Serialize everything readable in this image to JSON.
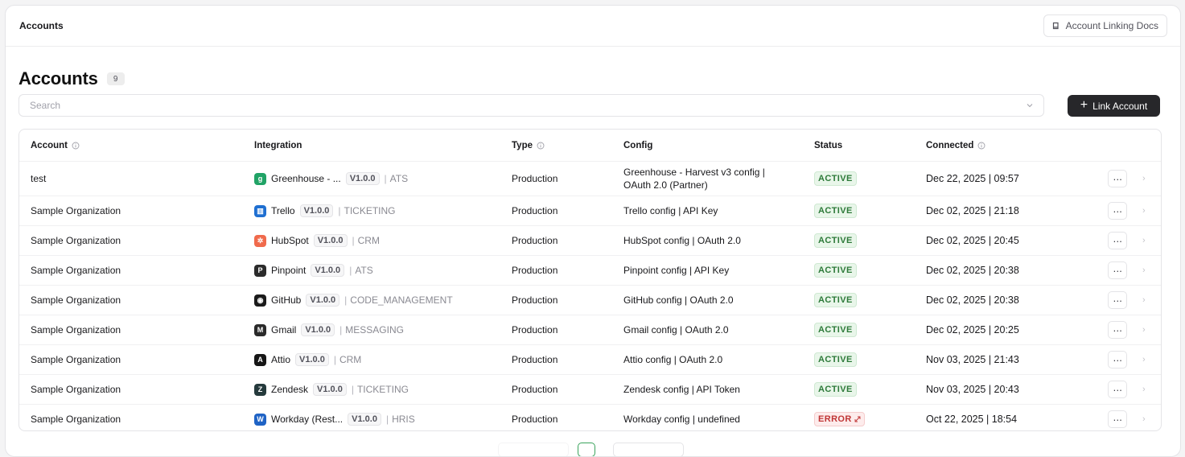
{
  "topbar": {
    "title": "Accounts",
    "docs_label": "Account Linking Docs"
  },
  "page": {
    "title": "Accounts",
    "count": "9"
  },
  "search": {
    "placeholder": "Search",
    "value": ""
  },
  "link_button": {
    "label": "Link Account"
  },
  "table": {
    "headers": {
      "account": "Account",
      "integration": "Integration",
      "type": "Type",
      "config": "Config",
      "status": "Status",
      "connected": "Connected"
    },
    "rows": [
      {
        "account": "test",
        "integration": "Greenhouse - ...",
        "version": "V1.0.0",
        "category": "ATS",
        "type": "Production",
        "config": "Greenhouse - Harvest v3 config | OAuth 2.0 (Partner)",
        "status": "ACTIVE",
        "connected": "Dec 22, 2025 | 09:57",
        "logo_color": "#21a366",
        "logo_glyph": "g"
      },
      {
        "account": "Sample Organization",
        "integration": "Trello",
        "version": "V1.0.0",
        "category": "TICKETING",
        "type": "Production",
        "config": "Trello config | API Key",
        "status": "ACTIVE",
        "connected": "Dec 02, 2025 | 21:18",
        "logo_color": "#1f6fd1",
        "logo_glyph": "▥"
      },
      {
        "account": "Sample Organization",
        "integration": "HubSpot",
        "version": "V1.0.0",
        "category": "CRM",
        "type": "Production",
        "config": "HubSpot config | OAuth 2.0",
        "status": "ACTIVE",
        "connected": "Dec 02, 2025 | 20:45",
        "logo_color": "#f06a4c",
        "logo_glyph": "✲"
      },
      {
        "account": "Sample Organization",
        "integration": "Pinpoint",
        "version": "V1.0.0",
        "category": "ATS",
        "type": "Production",
        "config": "Pinpoint config | API Key",
        "status": "ACTIVE",
        "connected": "Dec 02, 2025 | 20:38",
        "logo_color": "#2b2b2b",
        "logo_glyph": "P"
      },
      {
        "account": "Sample Organization",
        "integration": "GitHub",
        "version": "V1.0.0",
        "category": "CODE_MANAGEMENT",
        "type": "Production",
        "config": "GitHub config | OAuth 2.0",
        "status": "ACTIVE",
        "connected": "Dec 02, 2025 | 20:38",
        "logo_color": "#1b1b1b",
        "logo_glyph": "◉"
      },
      {
        "account": "Sample Organization",
        "integration": "Gmail",
        "version": "V1.0.0",
        "category": "MESSAGING",
        "type": "Production",
        "config": "Gmail config | OAuth 2.0",
        "status": "ACTIVE",
        "connected": "Dec 02, 2025 | 20:25",
        "logo_color": "#2a2a2a",
        "logo_glyph": "M"
      },
      {
        "account": "Sample Organization",
        "integration": "Attio",
        "version": "V1.0.0",
        "category": "CRM",
        "type": "Production",
        "config": "Attio config | OAuth 2.0",
        "status": "ACTIVE",
        "connected": "Nov 03, 2025 | 21:43",
        "logo_color": "#161616",
        "logo_glyph": "A"
      },
      {
        "account": "Sample Organization",
        "integration": "Zendesk",
        "version": "V1.0.0",
        "category": "TICKETING",
        "type": "Production",
        "config": "Zendesk config | API Token",
        "status": "ACTIVE",
        "connected": "Nov 03, 2025 | 20:43",
        "logo_color": "#253a3c",
        "logo_glyph": "Z"
      },
      {
        "account": "Sample Organization",
        "integration": "Workday (Rest...",
        "version": "V1.0.0",
        "category": "HRIS",
        "type": "Production",
        "config": "Workday config | undefined",
        "status": "ERROR",
        "connected": "Oct 22, 2025 | 18:54",
        "logo_color": "#1f63c5",
        "logo_glyph": "W"
      }
    ]
  },
  "icons": {
    "book": "book-icon",
    "chevron": "chevron-down-icon",
    "info": "info-icon",
    "more": "more-horizontal-icon",
    "arrow": "chevron-right-icon"
  },
  "colors": {
    "accent_dark": "#27272a",
    "active_green": "#2d7a39",
    "error_red": "#c03535"
  }
}
